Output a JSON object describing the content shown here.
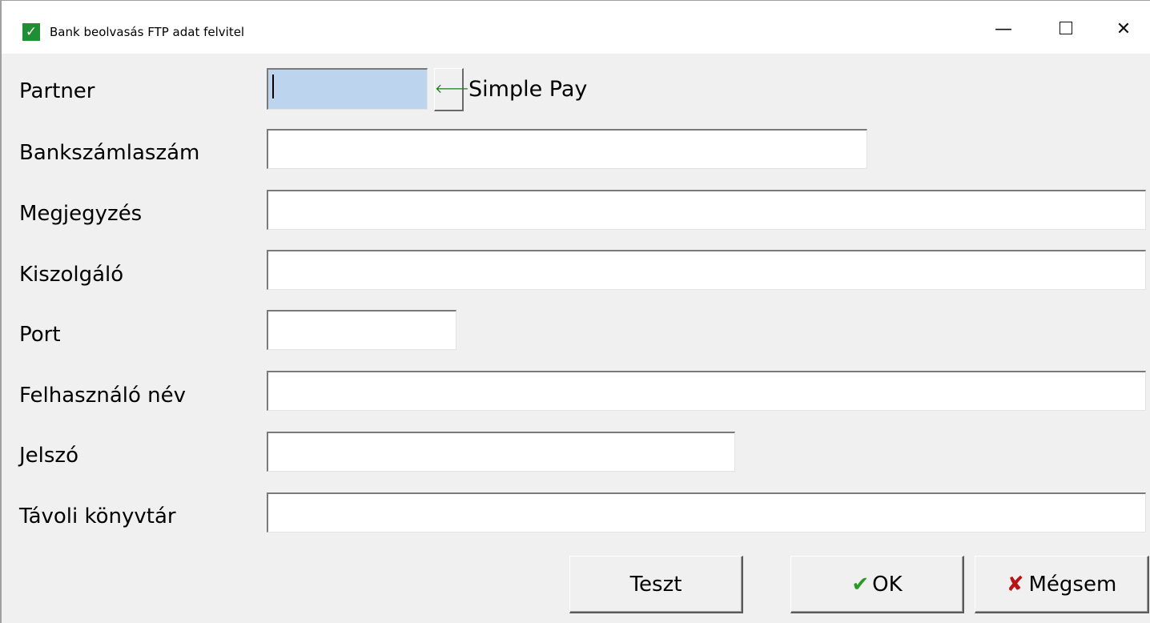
{
  "window": {
    "title": "Bank beolvasás FTP adat felvitel",
    "icon": "green-check-icon",
    "controls": {
      "minimize": "—",
      "maximize": "□",
      "close": "✕"
    }
  },
  "form": {
    "partner": {
      "label": "Partner",
      "code": "",
      "lookup_icon": "arrow-left-icon",
      "name": "Simple Pay"
    },
    "bank_account": {
      "label": "Bankszámlaszám",
      "value": ""
    },
    "note": {
      "label": "Megjegyzés",
      "value": ""
    },
    "server": {
      "label": "Kiszolgáló",
      "value": ""
    },
    "port": {
      "label": "Port",
      "value": ""
    },
    "username": {
      "label": "Felhasználó név",
      "value": ""
    },
    "password": {
      "label": "Jelszó",
      "value": ""
    },
    "remote_dir": {
      "label": "Távoli könyvtár",
      "value": ""
    }
  },
  "buttons": {
    "test": "Teszt",
    "ok": "OK",
    "cancel": "Mégsem",
    "ok_icon": "✔",
    "cancel_icon": "✘"
  },
  "colors": {
    "accent_green": "#1f8f36",
    "cancel_red": "#b81414",
    "partner_field_bg": "#bcd4ee"
  }
}
